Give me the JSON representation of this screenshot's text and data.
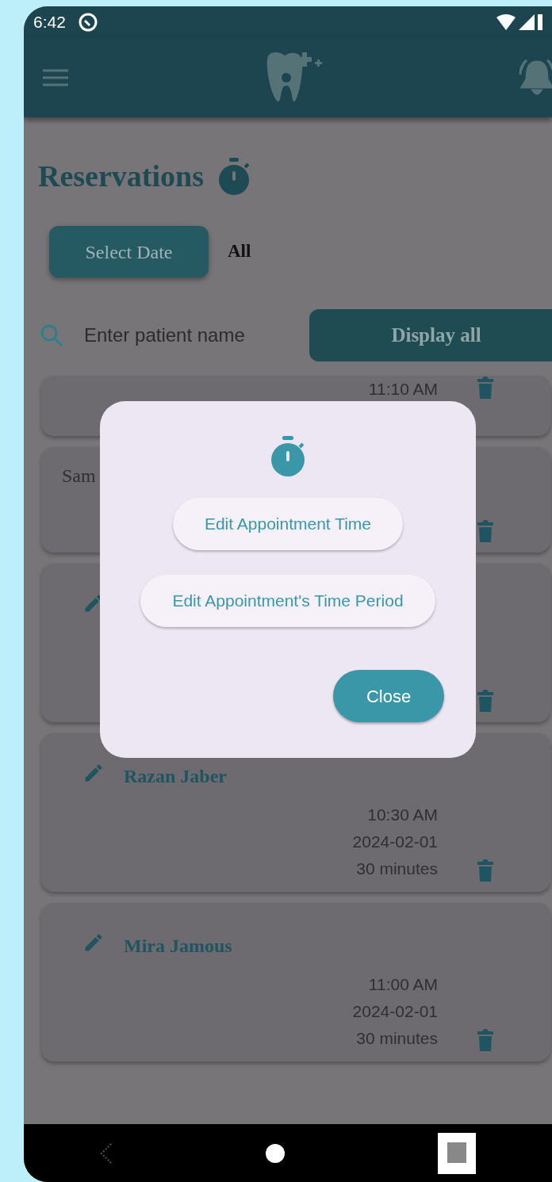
{
  "status_bar": {
    "time": "6:42"
  },
  "title": "Reservations",
  "filter": {
    "button": "Select Date",
    "value": "All"
  },
  "search": {
    "placeholder": "Enter patient name",
    "button": "Display all"
  },
  "reservations": [
    {
      "kind": "plain",
      "time": "11:10 AM"
    },
    {
      "kind": "plain",
      "name": "Sam"
    },
    {
      "kind": "edit"
    },
    {
      "kind": "edit",
      "name": "Razan Jaber",
      "time": "10:30 AM",
      "date": "2024-02-01",
      "duration": "30 minutes"
    },
    {
      "kind": "edit",
      "name": "Mira Jamous",
      "time": "11:00 AM",
      "date": "2024-02-01",
      "duration": "30 minutes"
    }
  ],
  "dialog": {
    "options": [
      "Edit Appointment Time",
      "Edit Appointment's Time Period"
    ],
    "close": "Close"
  }
}
